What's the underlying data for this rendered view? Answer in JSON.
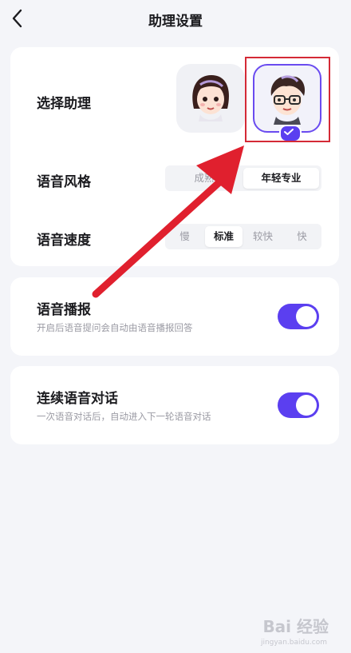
{
  "header": {
    "title": "助理设置"
  },
  "assistant": {
    "label": "选择助理",
    "options": [
      "female-avatar",
      "male-avatar"
    ],
    "selected": "male-avatar"
  },
  "voice_style": {
    "label": "语音风格",
    "options": [
      "成熟稳重",
      "年轻专业"
    ],
    "options_visible": [
      "成熟",
      "年轻专业"
    ],
    "selected": "年轻专业"
  },
  "speech_speed": {
    "label": "语音速度",
    "options": [
      "慢",
      "标准",
      "较快",
      "快"
    ],
    "selected": "标准"
  },
  "voice_broadcast": {
    "label": "语音播报",
    "desc": "开启后语音提问会自动由语音播报回答",
    "enabled": true
  },
  "continuous_dialog": {
    "label": "连续语音对话",
    "desc": "一次语音对话后，自动进入下一轮语音对话",
    "enabled": true
  },
  "watermark": {
    "brand": "Bai 经验",
    "url": "jingyan.baidu.com"
  },
  "colors": {
    "accent": "#5b3ff0",
    "annotation": "#e0202e"
  }
}
